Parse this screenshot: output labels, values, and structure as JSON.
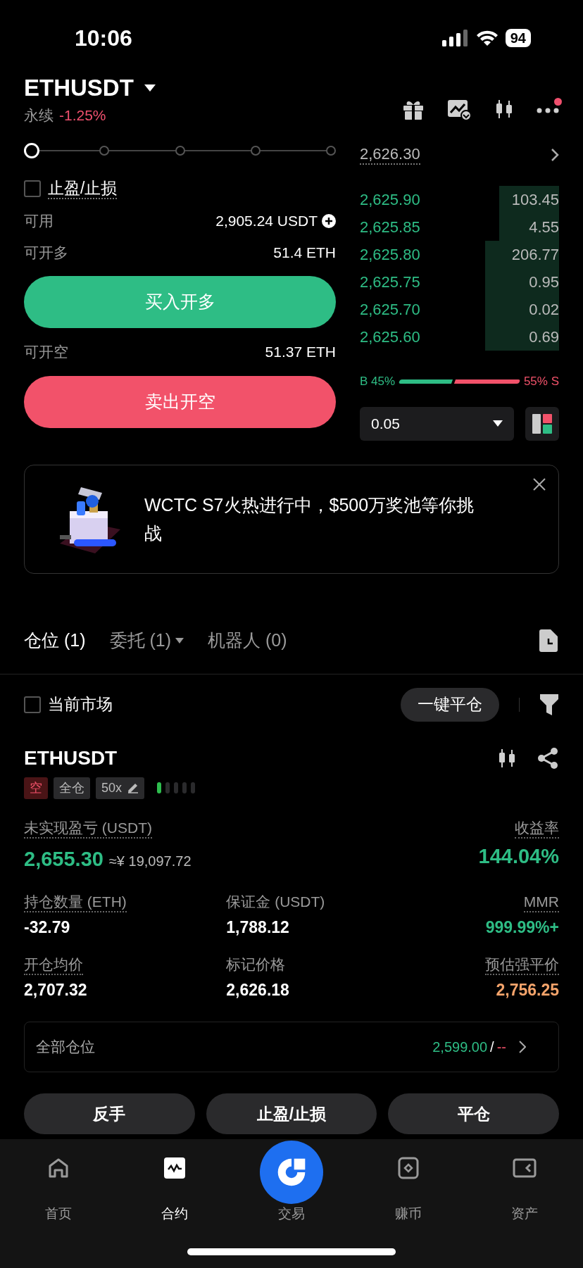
{
  "status_bar": {
    "time": "10:06",
    "battery": "94"
  },
  "header": {
    "symbol": "ETHUSDT",
    "type": "永续",
    "change": "-1.25%",
    "notification": true
  },
  "order_form": {
    "slider": {
      "level": 0
    },
    "tpsl": {
      "label": "止盈/止损",
      "checked": false
    },
    "available": {
      "label": "可用",
      "value": "2,905.24 USDT"
    },
    "long_max": {
      "label": "可开多",
      "value": "51.4 ETH"
    },
    "buy_button": "买入开多",
    "short_max": {
      "label": "可开空",
      "value": "51.37 ETH"
    },
    "sell_button": "卖出开空"
  },
  "order_book": {
    "last_price": "2,626.30",
    "bids": [
      {
        "price": "2,625.90",
        "size": "103.45"
      },
      {
        "price": "2,625.85",
        "size": "4.55"
      },
      {
        "price": "2,625.80",
        "size": "206.77"
      },
      {
        "price": "2,625.75",
        "size": "0.95"
      },
      {
        "price": "2,625.70",
        "size": "0.02"
      },
      {
        "price": "2,625.60",
        "size": "0.69"
      }
    ],
    "ratio": {
      "buy_label": "B 45%",
      "sell_label": "55% S"
    },
    "precision": "0.05"
  },
  "banner": {
    "text": "WCTC S7火热进行中，$500万奖池等你挑战"
  },
  "tabs": [
    {
      "label": "仓位 (1)",
      "selected": true,
      "dropdown": false
    },
    {
      "label": "委托 (1)",
      "selected": false,
      "dropdown": true
    },
    {
      "label": "机器人 (0)",
      "selected": false,
      "dropdown": false
    }
  ],
  "filter": {
    "label": "当前市场",
    "checked": false,
    "close_all": "一键平仓"
  },
  "position": {
    "symbol": "ETHUSDT",
    "tags": [
      {
        "kind": "side",
        "label": "空"
      },
      {
        "kind": "mode",
        "label": "全仓"
      },
      {
        "kind": "leverage",
        "label": "50x"
      }
    ],
    "pnl_label": "未实现盈亏 (USDT)",
    "pnl": "2,655.30",
    "pnl_cny": "≈¥ 19,097.72",
    "roe_label": "收益率",
    "roe": "144.04%",
    "stats": [
      {
        "label": "持仓数量 (ETH)",
        "value": "-32.79",
        "kind": "plain",
        "dotted": true
      },
      {
        "label": "保证金 (USDT)",
        "value": "1,788.12",
        "kind": "plain",
        "dotted": false
      },
      {
        "label": "MMR",
        "value": "999.99%+",
        "kind": "safe",
        "dotted": true
      },
      {
        "label": "开仓均价",
        "value": "2,707.32",
        "kind": "plain",
        "dotted": true
      },
      {
        "label": "标记价格",
        "value": "2,626.18",
        "kind": "plain",
        "dotted": false
      },
      {
        "label": "预估强平价",
        "value": "2,756.25",
        "kind": "liquidation",
        "dotted": true
      }
    ],
    "all_positions": {
      "label": "全部仓位",
      "value": "2,599.00",
      "separator": "/",
      "value2": "--"
    },
    "actions": [
      "反手",
      "止盈/止损",
      "平仓"
    ]
  },
  "nav": [
    {
      "label": "首页",
      "selected": false,
      "kind": "home"
    },
    {
      "label": "合约",
      "selected": true,
      "kind": "futures"
    },
    {
      "label": "交易",
      "selected": false,
      "kind": "trade"
    },
    {
      "label": "赚币",
      "selected": false,
      "kind": "earn"
    },
    {
      "label": "资产",
      "selected": false,
      "kind": "assets"
    }
  ]
}
